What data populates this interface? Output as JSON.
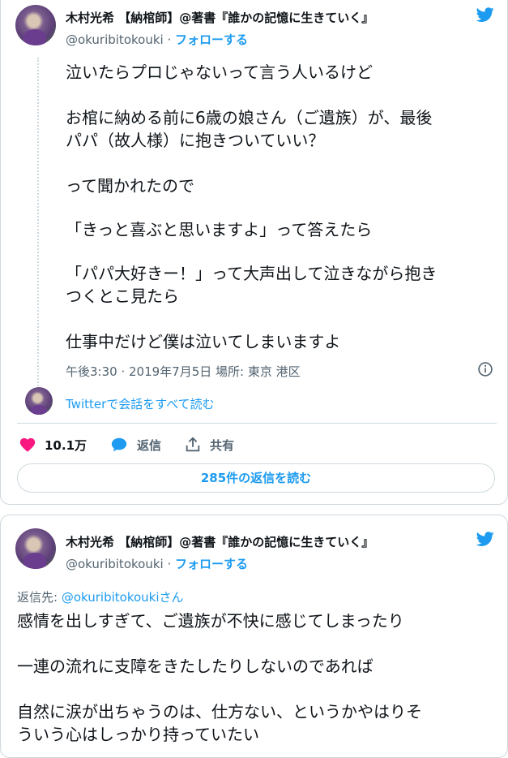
{
  "tweet1": {
    "author_name": "木村光希 【納棺師】@著書『誰かの記憶に生きていく』",
    "handle": "@okuribitokouki",
    "separator": "·",
    "follow_label": "フォローする",
    "lines": [
      "泣いたらプロじゃないって言う人いるけど",
      "お棺に納める前に6歳の娘さん（ご遺族）が、最後",
      "パパ（故人様）に抱きついていい？",
      "って聞かれたので",
      "「きっと喜ぶと思いますよ」って答えたら",
      "「パパ大好きー！」って大声出して泣きながら抱き",
      "つくとこ見たら",
      "仕事中だけど僕は泣いてしまいますよ"
    ],
    "timestamp": "午後3:30 · 2019年7月5日 場所: 東京 港区",
    "conversation_link": "Twitterで会話をすべて読む",
    "likes": "10.1万",
    "reply_label": "返信",
    "share_label": "共有",
    "read_replies": "285件の返信を読む"
  },
  "tweet2": {
    "author_name": "木村光希 【納棺師】@著書『誰かの記憶に生きていく』",
    "handle": "@okuribitokouki",
    "separator": "·",
    "follow_label": "フォローする",
    "reply_prefix": "返信先: ",
    "reply_mention": "@okuribitokoukiさん",
    "lines": [
      "感情を出しすぎて、ご遺族が不快に感じてしまったり",
      "一連の流れに支障をきたしたりしないのであれば",
      "自然に涙が出ちゃうのは、仕方ない、というかやはりそ",
      "ういう心はしっかり持っていたい"
    ]
  },
  "colors": {
    "accent": "#1d9bf0",
    "like": "#f91880",
    "muted": "#536471",
    "border": "#cfd9de"
  },
  "icons": [
    "twitter-bird-icon",
    "info-icon",
    "heart-icon",
    "reply-bubble-icon",
    "share-icon"
  ]
}
